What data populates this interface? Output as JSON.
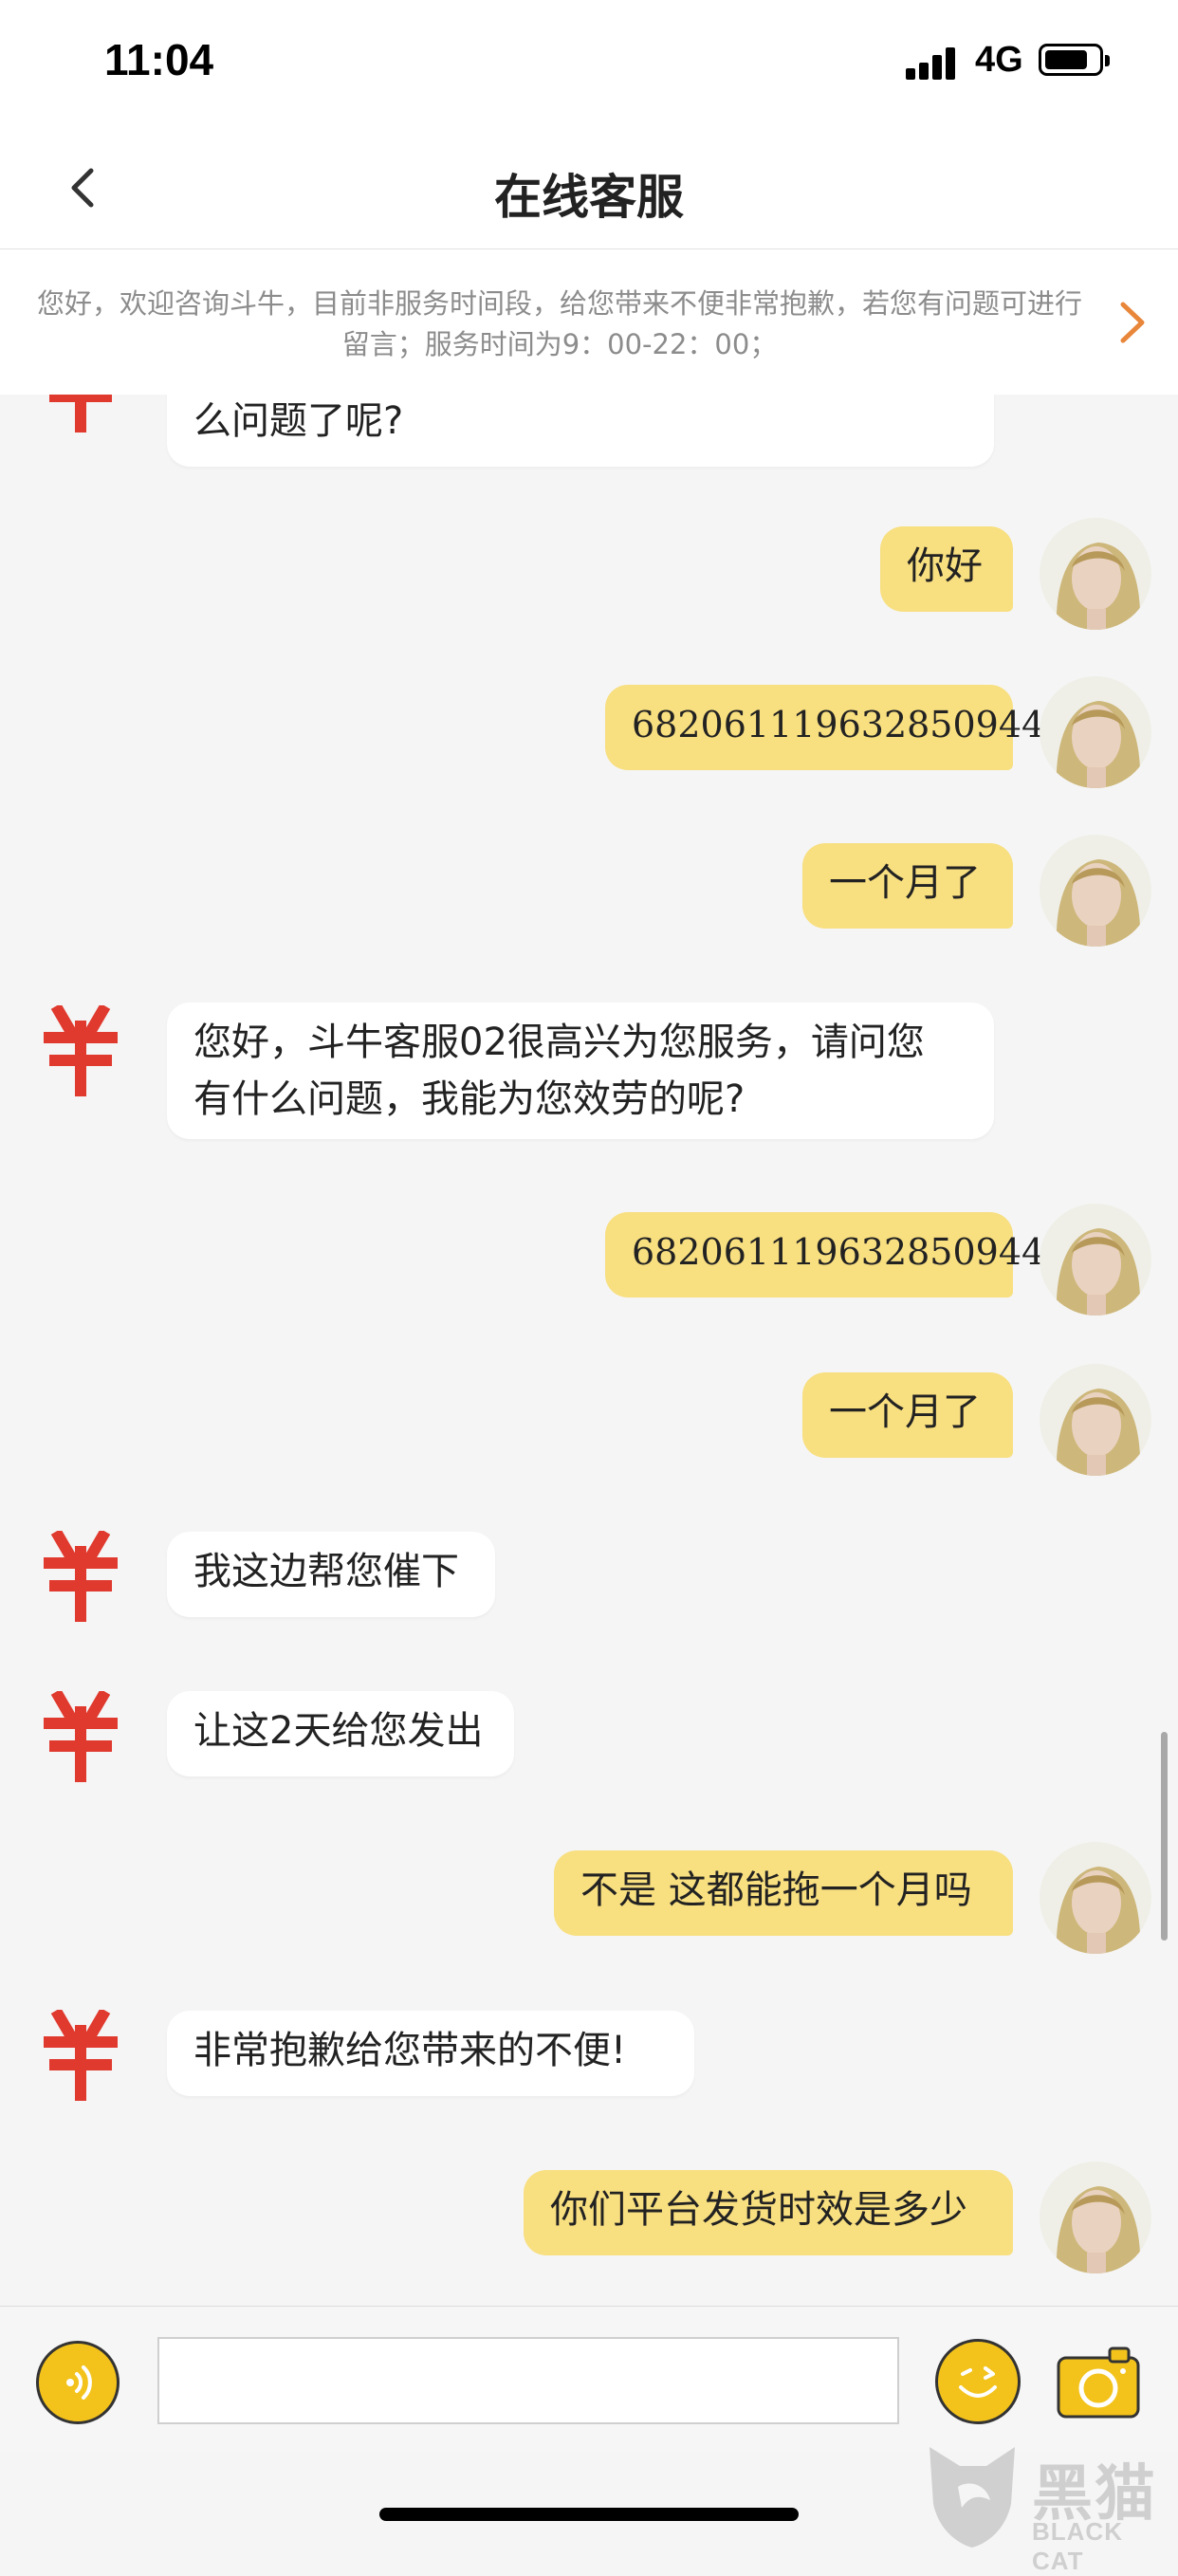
{
  "status_bar": {
    "time": "11:04",
    "network": "4G"
  },
  "nav": {
    "title": "在线客服"
  },
  "notice": {
    "text": "您好，欢迎咨询斗牛，目前非服务时间段，给您带来不便非常抱歉，若您有问题可进行留言；服务时间为9：00-22：00；"
  },
  "messages": [
    {
      "side": "left",
      "text": "么问题了呢?"
    },
    {
      "side": "right",
      "text": "你好"
    },
    {
      "side": "right",
      "text": "682061119632850944"
    },
    {
      "side": "right",
      "text": "一个月了"
    },
    {
      "side": "left",
      "line1": "您好，斗牛客服02很高兴为您服务，请问您",
      "line2": "有什么问题，我能为您效劳的呢?"
    },
    {
      "side": "right",
      "text": "682061119632850944"
    },
    {
      "side": "right",
      "text": "一个月了"
    },
    {
      "side": "left",
      "text": "我这边帮您催下"
    },
    {
      "side": "left",
      "text": "让这2天给您发出"
    },
    {
      "side": "right",
      "text": "不是 这都能拖一个月吗"
    },
    {
      "side": "left",
      "text": "非常抱歉给您带来的不便!"
    },
    {
      "side": "right",
      "text": "你们平台发货时效是多少"
    }
  ],
  "icons": {
    "back": "chevron-left-icon",
    "notice_more": "chevron-right-icon",
    "voice": "voice-icon",
    "emoji": "emoji-icon",
    "camera": "camera-icon"
  },
  "watermark": {
    "text": "黑猫",
    "sub": "BLACK CAT"
  },
  "colors": {
    "user_bubble": "#f8df80",
    "accent": "#f3c31c",
    "notice_arrow": "#e8863a",
    "agent_logo": "#e0392e"
  }
}
